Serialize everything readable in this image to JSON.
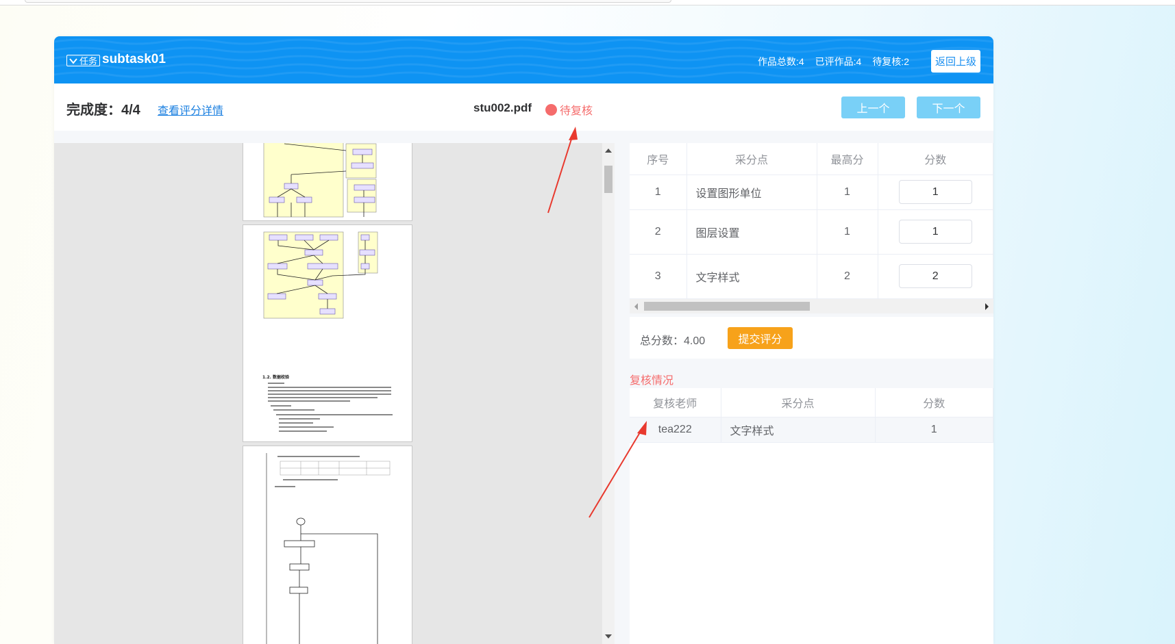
{
  "header": {
    "task_tag": "任务",
    "task_name": "subtask01",
    "stats": [
      "作品总数:4",
      "已评作品:4",
      "待复核:2"
    ],
    "back_label": "返回上级"
  },
  "infobar": {
    "completion": "完成度：4/4",
    "detail_link": "查看评分详情",
    "filename": "stu002.pdf",
    "status": "待复核",
    "prev_label": "上一个",
    "next_label": "下一个"
  },
  "score_table": {
    "headers": [
      "序号",
      "采分点",
      "最高分",
      "分数"
    ],
    "rows": [
      {
        "index": "1",
        "item": "设置图形单位",
        "max": "1",
        "score": "1"
      },
      {
        "index": "2",
        "item": "图层设置",
        "max": "1",
        "score": "1"
      },
      {
        "index": "3",
        "item": "文字样式",
        "max": "2",
        "score": "2"
      }
    ]
  },
  "total": {
    "label": "总分数：4.00",
    "submit_label": "提交评分"
  },
  "review": {
    "title": "复核情况",
    "headers": [
      "复核老师",
      "采分点",
      "分数"
    ],
    "rows": [
      {
        "teacher": "tea222",
        "item": "文字样式",
        "score": "1"
      }
    ]
  },
  "document": {
    "section_heading": "1.2. 数据校验"
  },
  "colors": {
    "header_blue": "#0e93f3",
    "nav_button": "#79d0f7",
    "submit_orange": "#f7a21a",
    "status_red": "#f56c6c",
    "annotation_arrow": "#e8392e"
  }
}
